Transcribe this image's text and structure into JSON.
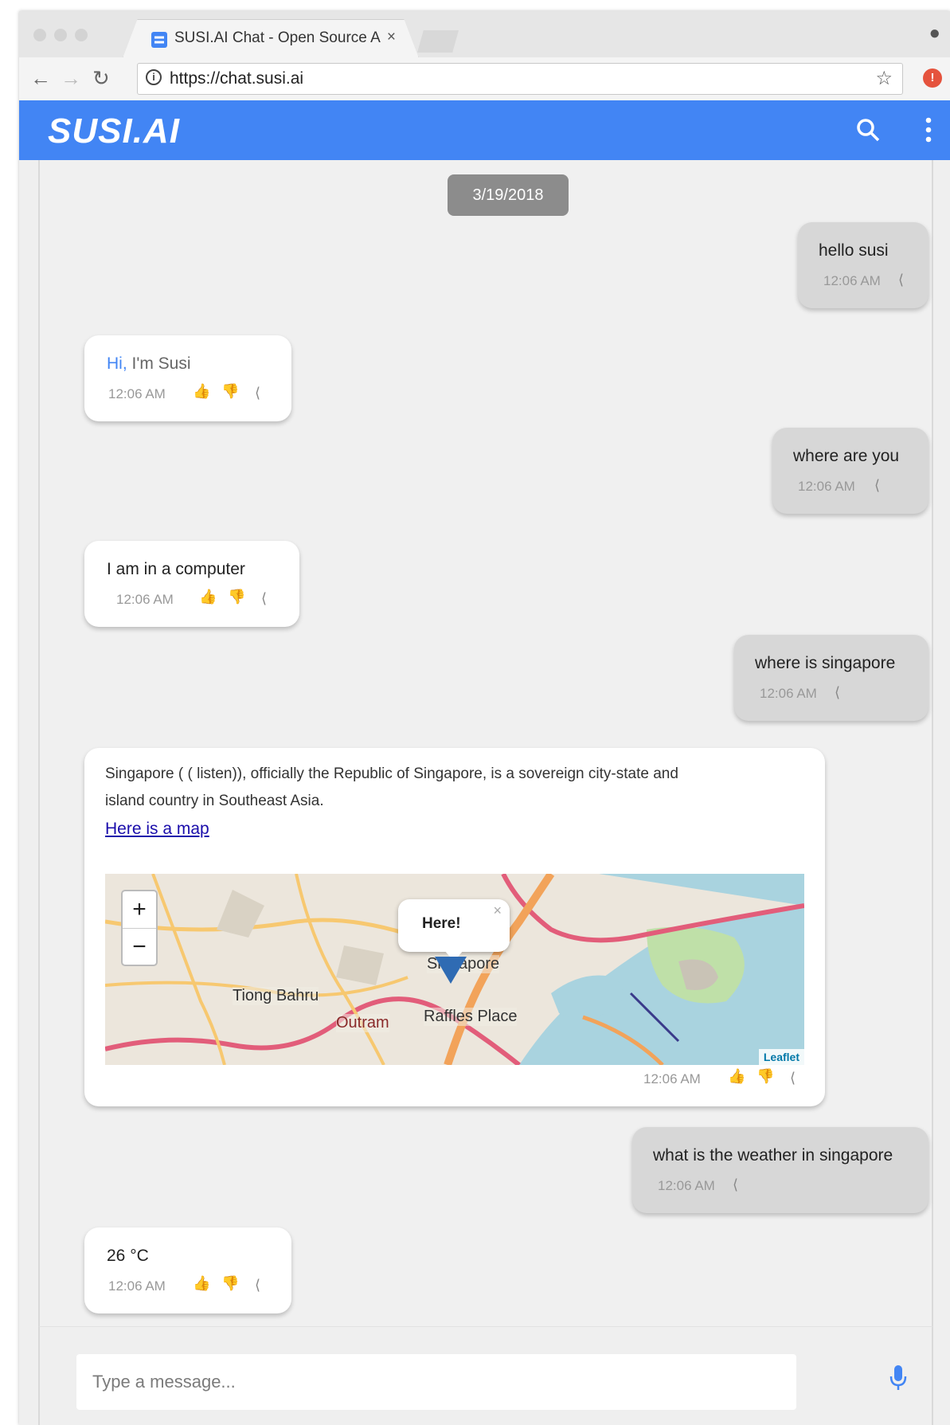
{
  "browser": {
    "tab_title": "SUSI.AI Chat - Open Source AI",
    "tab_close": "×",
    "url": "https://chat.susi.ai"
  },
  "app": {
    "logo": "SUSI.AI",
    "brand_color": "#4285f4"
  },
  "chat": {
    "date": "3/19/2018",
    "messages": [
      {
        "from": "user",
        "text": "hello susi",
        "time": "12:06 AM"
      },
      {
        "from": "susi",
        "text_highlight": "Hi,",
        "text": " I'm Susi",
        "time": "12:06 AM"
      },
      {
        "from": "user",
        "text": "where are you",
        "time": "12:06 AM"
      },
      {
        "from": "susi",
        "text": "I am in a computer",
        "time": "12:06 AM"
      },
      {
        "from": "user",
        "text": "where is singapore",
        "time": "12:06 AM"
      },
      {
        "from": "susi",
        "text_line1": "Singapore ( ( listen)), officially the Republic of Singapore, is a sovereign city-state and",
        "text_line2": "island country in Southeast Asia.",
        "link": "Here is a map",
        "time": "12:06 AM",
        "map": {
          "popup": "Here!",
          "popup_close": "×",
          "zoom_in": "+",
          "zoom_out": "−",
          "attribution": "Leaflet",
          "labels": [
            "Singapore",
            "Tiong Bahru",
            "Raffles Place",
            "Outram"
          ]
        }
      },
      {
        "from": "user",
        "text": "what is the weather in singapore",
        "time": "12:06 AM"
      },
      {
        "from": "susi",
        "text": "26 °C",
        "time": "12:06 AM"
      }
    ]
  },
  "composer": {
    "placeholder": "Type a message..."
  }
}
